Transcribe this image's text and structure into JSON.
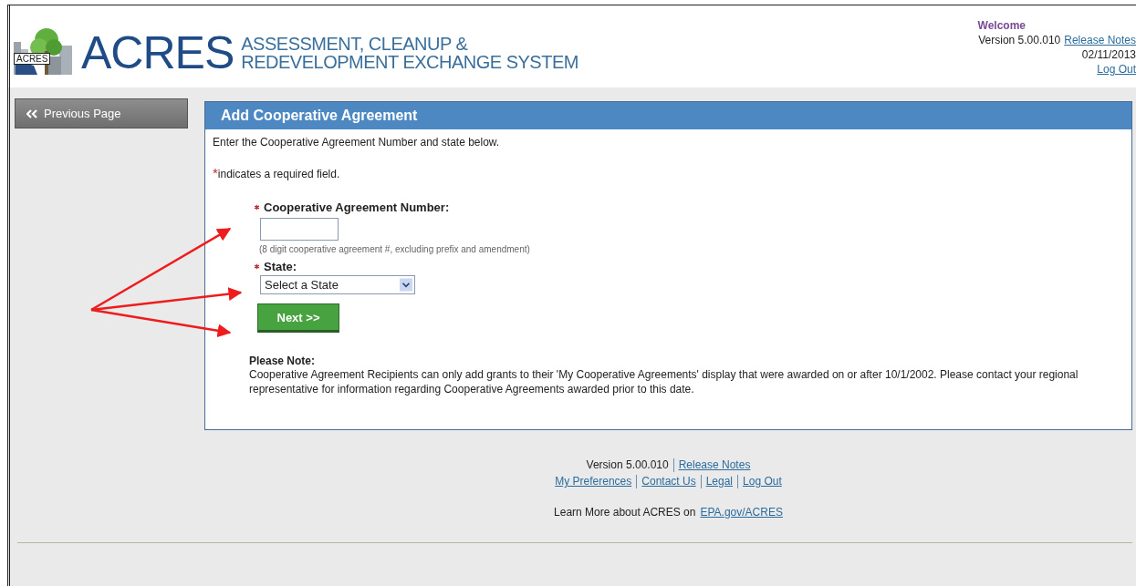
{
  "header": {
    "logo": {
      "badge": "ACRES",
      "wordmark": "ACRES",
      "subtitle_lines": [
        "ASSESSMENT, CLEANUP &",
        "REDEVELOPMENT EXCHANGE SYSTEM"
      ]
    },
    "user_panel": {
      "welcome": "Welcome",
      "version": "Version 5.00.010",
      "release_notes": "Release Notes",
      "date": "02/11/2013",
      "logout": "Log Out"
    }
  },
  "sidebar": {
    "previous_page": "Previous Page"
  },
  "panel": {
    "title": "Add Cooperative Agreement",
    "intro": "Enter the Cooperative Agreement Number and state below.",
    "required_note": {
      "mark": "*",
      "text": "indicates a required field."
    },
    "fields": [
      {
        "kind": "text",
        "label": "Cooperative Agreement Number:",
        "required": true,
        "hint": "(8 digit cooperative agreement #, excluding prefix and amendment)"
      },
      {
        "kind": "select",
        "label": "State:",
        "required": true,
        "value": "Select a State"
      }
    ],
    "button": "Next >>",
    "note_title": "Please Note:",
    "note_text": "Cooperative Agreement Recipients can only add grants to their 'My Cooperative Agreements' display that were awarded on or after 10/1/2002. Please contact your regional representative for information regarding Cooperative Agreements awarded prior to this date."
  },
  "footer": {
    "version": "Version 5.00.010",
    "release_notes": "Release Notes",
    "links": [
      "My Preferences",
      "Contact Us",
      "Legal",
      "Log Out"
    ],
    "learn_more": "Learn More about ACRES on",
    "learn_more_link": "EPA.gov/ACRES"
  }
}
